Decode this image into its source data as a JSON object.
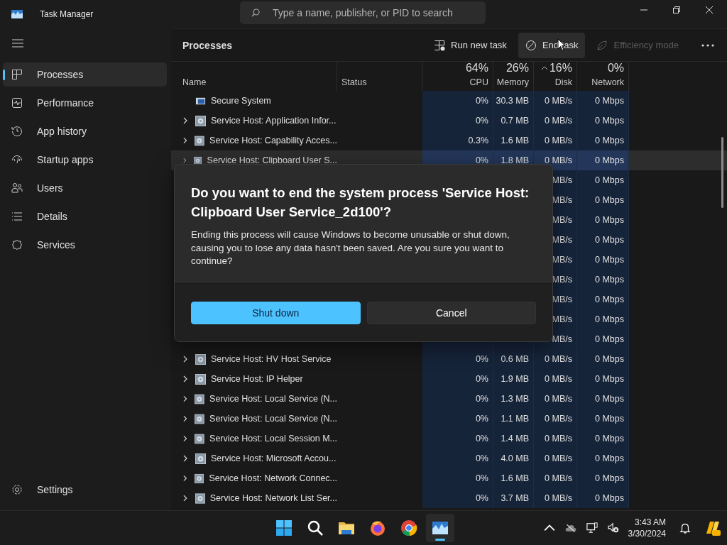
{
  "window": {
    "title": "Task Manager"
  },
  "search": {
    "placeholder": "Type a name, publisher, or PID to search"
  },
  "sidebar": {
    "items": [
      {
        "label": "Processes",
        "kind": "processes",
        "selected": true
      },
      {
        "label": "Performance",
        "kind": "performance",
        "selected": false
      },
      {
        "label": "App history",
        "kind": "history",
        "selected": false
      },
      {
        "label": "Startup apps",
        "kind": "startup",
        "selected": false
      },
      {
        "label": "Users",
        "kind": "users",
        "selected": false
      },
      {
        "label": "Details",
        "kind": "details",
        "selected": false
      },
      {
        "label": "Services",
        "kind": "services",
        "selected": false
      }
    ],
    "settings": "Settings"
  },
  "page_title": "Processes",
  "toolbar": [
    {
      "label": "Run new task",
      "kind": "run",
      "disabled": false,
      "hovered": false
    },
    {
      "label": "End task",
      "kind": "end",
      "disabled": false,
      "hovered": true
    },
    {
      "label": "Efficiency mode",
      "kind": "efficiency",
      "disabled": true,
      "hovered": false
    }
  ],
  "table": {
    "columns": [
      {
        "label": "Name",
        "sorted": false
      },
      {
        "label": "Status",
        "sorted": false
      },
      {
        "label": "CPU",
        "percent": "64%",
        "sorted": false
      },
      {
        "label": "Memory",
        "percent": "26%",
        "sorted": false
      },
      {
        "label": "Disk",
        "percent": "16%",
        "sorted": true
      },
      {
        "label": "Network",
        "percent": "0%",
        "sorted": false
      }
    ],
    "rows": [
      {
        "kind": "system",
        "name": "Secure System",
        "expandable": false,
        "selected": false,
        "cpu": "0%",
        "memory": "30.3 MB",
        "disk": "0 MB/s",
        "network": "0 Mbps"
      },
      {
        "kind": "service",
        "name": "Service Host: Application Infor...",
        "expandable": true,
        "selected": false,
        "cpu": "0%",
        "memory": "0.7 MB",
        "disk": "0 MB/s",
        "network": "0 Mbps"
      },
      {
        "kind": "service",
        "name": "Service Host: Capability Acces...",
        "expandable": true,
        "selected": false,
        "cpu": "0.3%",
        "memory": "1.6 MB",
        "disk": "0 MB/s",
        "network": "0 Mbps"
      },
      {
        "kind": "service",
        "name": "Service Host: Clipboard User S...",
        "expandable": true,
        "selected": true,
        "cpu": "0%",
        "memory": "1.8 MB",
        "disk": "0 MB/s",
        "network": "0 Mbps"
      },
      {
        "kind": "covered",
        "disk": "MB/s",
        "network": "0 Mbps"
      },
      {
        "kind": "covered",
        "disk": "MB/s",
        "network": "0 Mbps"
      },
      {
        "kind": "covered",
        "disk": "MB/s",
        "network": "0 Mbps"
      },
      {
        "kind": "covered",
        "disk": "MB/s",
        "network": "0 Mbps"
      },
      {
        "kind": "covered",
        "disk": "MB/s",
        "network": "0 Mbps"
      },
      {
        "kind": "covered",
        "disk": "MB/s",
        "network": "0 Mbps"
      },
      {
        "kind": "covered",
        "disk": "MB/s",
        "network": "0 Mbps"
      },
      {
        "kind": "covered",
        "disk": "MB/s",
        "network": "0 Mbps"
      },
      {
        "kind": "covered",
        "disk": "MB/s",
        "network": "0 Mbps"
      },
      {
        "kind": "service",
        "name": "Service Host: HV Host Service",
        "expandable": true,
        "selected": false,
        "cpu": "0%",
        "memory": "0.6 MB",
        "disk": "0 MB/s",
        "network": "0 Mbps"
      },
      {
        "kind": "service",
        "name": "Service Host: IP Helper",
        "expandable": true,
        "selected": false,
        "cpu": "0%",
        "memory": "1.9 MB",
        "disk": "0 MB/s",
        "network": "0 Mbps"
      },
      {
        "kind": "service",
        "name": "Service Host: Local Service (N...",
        "expandable": true,
        "selected": false,
        "cpu": "0%",
        "memory": "1.3 MB",
        "disk": "0 MB/s",
        "network": "0 Mbps"
      },
      {
        "kind": "service",
        "name": "Service Host: Local Service (N...",
        "expandable": true,
        "selected": false,
        "cpu": "0%",
        "memory": "1.1 MB",
        "disk": "0 MB/s",
        "network": "0 Mbps"
      },
      {
        "kind": "service",
        "name": "Service Host: Local Session M...",
        "expandable": true,
        "selected": false,
        "cpu": "0%",
        "memory": "1.4 MB",
        "disk": "0 MB/s",
        "network": "0 Mbps"
      },
      {
        "kind": "service",
        "name": "Service Host: Microsoft Accou...",
        "expandable": true,
        "selected": false,
        "cpu": "0%",
        "memory": "4.0 MB",
        "disk": "0 MB/s",
        "network": "0 Mbps"
      },
      {
        "kind": "service",
        "name": "Service Host: Network Connec...",
        "expandable": true,
        "selected": false,
        "cpu": "0%",
        "memory": "1.6 MB",
        "disk": "0 MB/s",
        "network": "0 Mbps"
      },
      {
        "kind": "service",
        "name": "Service Host: Network List Ser...",
        "expandable": true,
        "selected": false,
        "cpu": "0%",
        "memory": "3.7 MB",
        "disk": "0 MB/s",
        "network": "0 Mbps"
      }
    ]
  },
  "dialog": {
    "title": "Do you want to end the system process 'Service Host: Clipboard User Service_2d100'?",
    "message": "Ending this process will cause Windows to become unusable or shut down, causing you to lose any data hasn't been saved. Are you sure you want to continue?",
    "buttons": [
      {
        "label": "Shut down",
        "primary": true
      },
      {
        "label": "Cancel",
        "primary": false
      }
    ]
  },
  "taskbar": {
    "apps": [
      {
        "kind": "start",
        "active": false
      },
      {
        "kind": "search",
        "active": false
      },
      {
        "kind": "files",
        "active": false
      },
      {
        "kind": "firefox",
        "active": false
      },
      {
        "kind": "chrome",
        "active": false
      },
      {
        "kind": "taskmanager",
        "active": true
      }
    ],
    "time": "3:43 AM",
    "date": "3/30/2024"
  }
}
